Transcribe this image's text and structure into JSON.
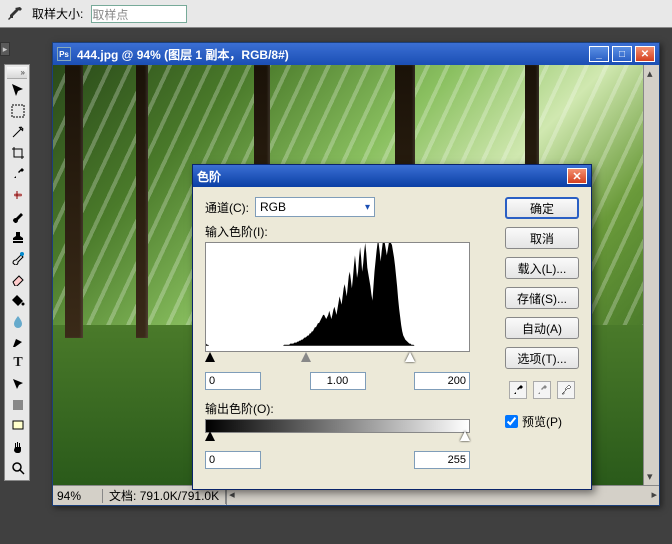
{
  "options_bar": {
    "sample_size_label": "取样大小:",
    "sample_size_value": "取样点"
  },
  "document": {
    "filename": "444.jpg",
    "zoom_title": "94%",
    "layer_info": "(图层 1 副本，RGB/8#)",
    "title_full": "444.jpg @ 94% (图层 1 副本，RGB/8#)",
    "zoom_status": "94%",
    "doc_label": "文档:",
    "doc_size": "791.0K/791.0K"
  },
  "levels": {
    "title": "色阶",
    "channel_label": "通道(C):",
    "channel_value": "RGB",
    "input_label": "输入色阶(I):",
    "in_shadow": "0",
    "in_mid": "1.00",
    "in_hilite": "200",
    "output_label": "输出色阶(O):",
    "out_shadow": "0",
    "out_hilite": "255",
    "buttons": {
      "ok": "确定",
      "cancel": "取消",
      "load": "载入(L)...",
      "save": "存储(S)...",
      "auto": "自动(A)",
      "options": "选项(T)..."
    },
    "preview_label": "预览(P)"
  },
  "chart_data": {
    "type": "bar",
    "title": "",
    "xlabel": "",
    "ylabel": "",
    "xlim": [
      0,
      255
    ],
    "categories_note": "256-bin luminance histogram; values are relative heights 0-100 estimated from image",
    "values": [
      2,
      1,
      1,
      0,
      0,
      0,
      0,
      0,
      0,
      0,
      0,
      0,
      0,
      0,
      0,
      0,
      0,
      0,
      0,
      0,
      0,
      0,
      0,
      0,
      0,
      0,
      0,
      0,
      0,
      0,
      0,
      0,
      0,
      0,
      0,
      0,
      0,
      0,
      0,
      0,
      0,
      0,
      0,
      0,
      0,
      0,
      0,
      0,
      0,
      0,
      0,
      0,
      0,
      0,
      0,
      0,
      0,
      0,
      0,
      0,
      0,
      0,
      0,
      0,
      0,
      0,
      0,
      0,
      0,
      0,
      0,
      0,
      0,
      0,
      0,
      0,
      1,
      1,
      1,
      1,
      1,
      1,
      2,
      2,
      2,
      2,
      3,
      3,
      3,
      4,
      4,
      5,
      5,
      6,
      6,
      7,
      8,
      8,
      9,
      10,
      10,
      12,
      12,
      14,
      14,
      16,
      18,
      18,
      20,
      22,
      22,
      24,
      26,
      28,
      30,
      30,
      28,
      26,
      28,
      30,
      34,
      30,
      26,
      30,
      35,
      38,
      34,
      30,
      36,
      42,
      48,
      44,
      40,
      48,
      56,
      60,
      54,
      48,
      58,
      68,
      72,
      64,
      56,
      66,
      78,
      88,
      78,
      66,
      72,
      86,
      96,
      86,
      72,
      80,
      92,
      100,
      90,
      76,
      70,
      64,
      58,
      50,
      44,
      58,
      72,
      82,
      92,
      100,
      100,
      92,
      82,
      92,
      100,
      100,
      100,
      94,
      88,
      94,
      100,
      100,
      100,
      98,
      92,
      86,
      78,
      68,
      58,
      46,
      36,
      28,
      20,
      14,
      10,
      8,
      6,
      5,
      4,
      3,
      2,
      2,
      1,
      1,
      1,
      0,
      0,
      0,
      0,
      0,
      0,
      0,
      0,
      0,
      0,
      0,
      0,
      0,
      0,
      0,
      0,
      0,
      0,
      0,
      0,
      0,
      0,
      0,
      0,
      0,
      0,
      0,
      0,
      0,
      0,
      0,
      0,
      0,
      0,
      0,
      0,
      0,
      0,
      0,
      0,
      0,
      0,
      0,
      0,
      0,
      0,
      0,
      0,
      0,
      0,
      0,
      0,
      0
    ]
  }
}
